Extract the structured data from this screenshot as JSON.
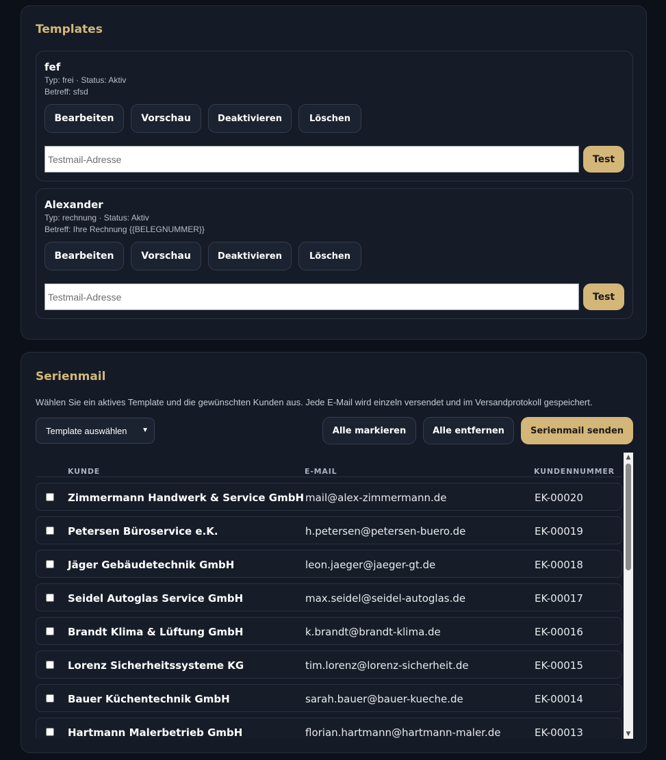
{
  "templates": {
    "title": "Templates",
    "items": [
      {
        "name": "fef",
        "meta": "Typ: frei · Status: Aktiv",
        "subject": "Betreff: sfsd",
        "edit_label": "Bearbeiten",
        "preview_label": "Vorschau",
        "deactivate_label": "Deaktivieren",
        "delete_label": "Löschen",
        "test_placeholder": "Testmail-Adresse",
        "test_value": "",
        "test_label": "Test"
      },
      {
        "name": "Alexander",
        "meta": "Typ: rechnung · Status: Aktiv",
        "subject": "Betreff: Ihre Rechnung {{BELEGNUMMER}}",
        "edit_label": "Bearbeiten",
        "preview_label": "Vorschau",
        "deactivate_label": "Deaktivieren",
        "delete_label": "Löschen",
        "test_placeholder": "Testmail-Adresse",
        "test_value": "",
        "test_label": "Test"
      }
    ]
  },
  "serienmail": {
    "title": "Serienmail",
    "description": "Wählen Sie ein aktives Template und die gewünschten Kunden aus. Jede E-Mail wird einzeln versendet und im Versandprotokoll gespeichert.",
    "select_value": "Template auswählen",
    "mark_all_label": "Alle markieren",
    "unmark_all_label": "Alle entfernen",
    "send_label": "Serienmail senden",
    "columns": {
      "kunde": "KUNDE",
      "email": "E-MAIL",
      "nummer": "KUNDENNUMMER"
    },
    "rows": [
      {
        "kunde": "Zimmermann Handwerk & Service GmbH",
        "email": "mail@alex-zimmermann.de",
        "nummer": "EK-00020"
      },
      {
        "kunde": "Petersen Büroservice e.K.",
        "email": "h.petersen@petersen-buero.de",
        "nummer": "EK-00019"
      },
      {
        "kunde": "Jäger Gebäudetechnik GmbH",
        "email": "leon.jaeger@jaeger-gt.de",
        "nummer": "EK-00018"
      },
      {
        "kunde": "Seidel Autoglas Service GmbH",
        "email": "max.seidel@seidel-autoglas.de",
        "nummer": "EK-00017"
      },
      {
        "kunde": "Brandt Klima & Lüftung GmbH",
        "email": "k.brandt@brandt-klima.de",
        "nummer": "EK-00016"
      },
      {
        "kunde": "Lorenz Sicherheitssysteme KG",
        "email": "tim.lorenz@lorenz-sicherheit.de",
        "nummer": "EK-00015"
      },
      {
        "kunde": "Bauer Küchentechnik GmbH",
        "email": "sarah.bauer@bauer-kueche.de",
        "nummer": "EK-00014"
      },
      {
        "kunde": "Hartmann Malerbetrieb GmbH",
        "email": "florian.hartmann@hartmann-maler.de",
        "nummer": "EK-00013"
      }
    ]
  },
  "icons": {
    "select_chevron": "chevron-down-icon",
    "scroll_up": "arrow-up-icon",
    "scroll_down": "arrow-down-icon"
  }
}
